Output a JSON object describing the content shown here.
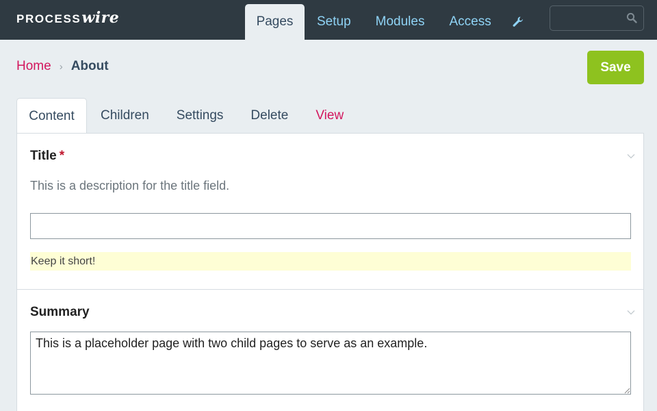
{
  "logo": {
    "part1": "PROCESS",
    "part2": "wire"
  },
  "topnav": {
    "items": [
      {
        "label": "Pages"
      },
      {
        "label": "Setup"
      },
      {
        "label": "Modules"
      },
      {
        "label": "Access"
      }
    ],
    "wrench_icon": "wrench-icon"
  },
  "search": {
    "value": "",
    "placeholder": "",
    "icon": "search-icon"
  },
  "breadcrumb": {
    "home": "Home",
    "separator": "›",
    "current": "About"
  },
  "save_label": "Save",
  "tabs": [
    {
      "label": "Content"
    },
    {
      "label": "Children"
    },
    {
      "label": "Settings"
    },
    {
      "label": "Delete"
    },
    {
      "label": "View"
    }
  ],
  "fields": {
    "title": {
      "label": "Title",
      "required_marker": "*",
      "description": "This is a description for the title field.",
      "value": "",
      "notes": "Keep it short!"
    },
    "summary": {
      "label": "Summary",
      "value": "This is a placeholder page with two child pages to serve as an example."
    }
  },
  "colors": {
    "topbar": "#2f3a42",
    "nav_link": "#8fd3f5",
    "accent_pink": "#d2165d",
    "save_green": "#8ec21f",
    "background": "#e9eef1",
    "notes_bg": "#fefed5"
  }
}
